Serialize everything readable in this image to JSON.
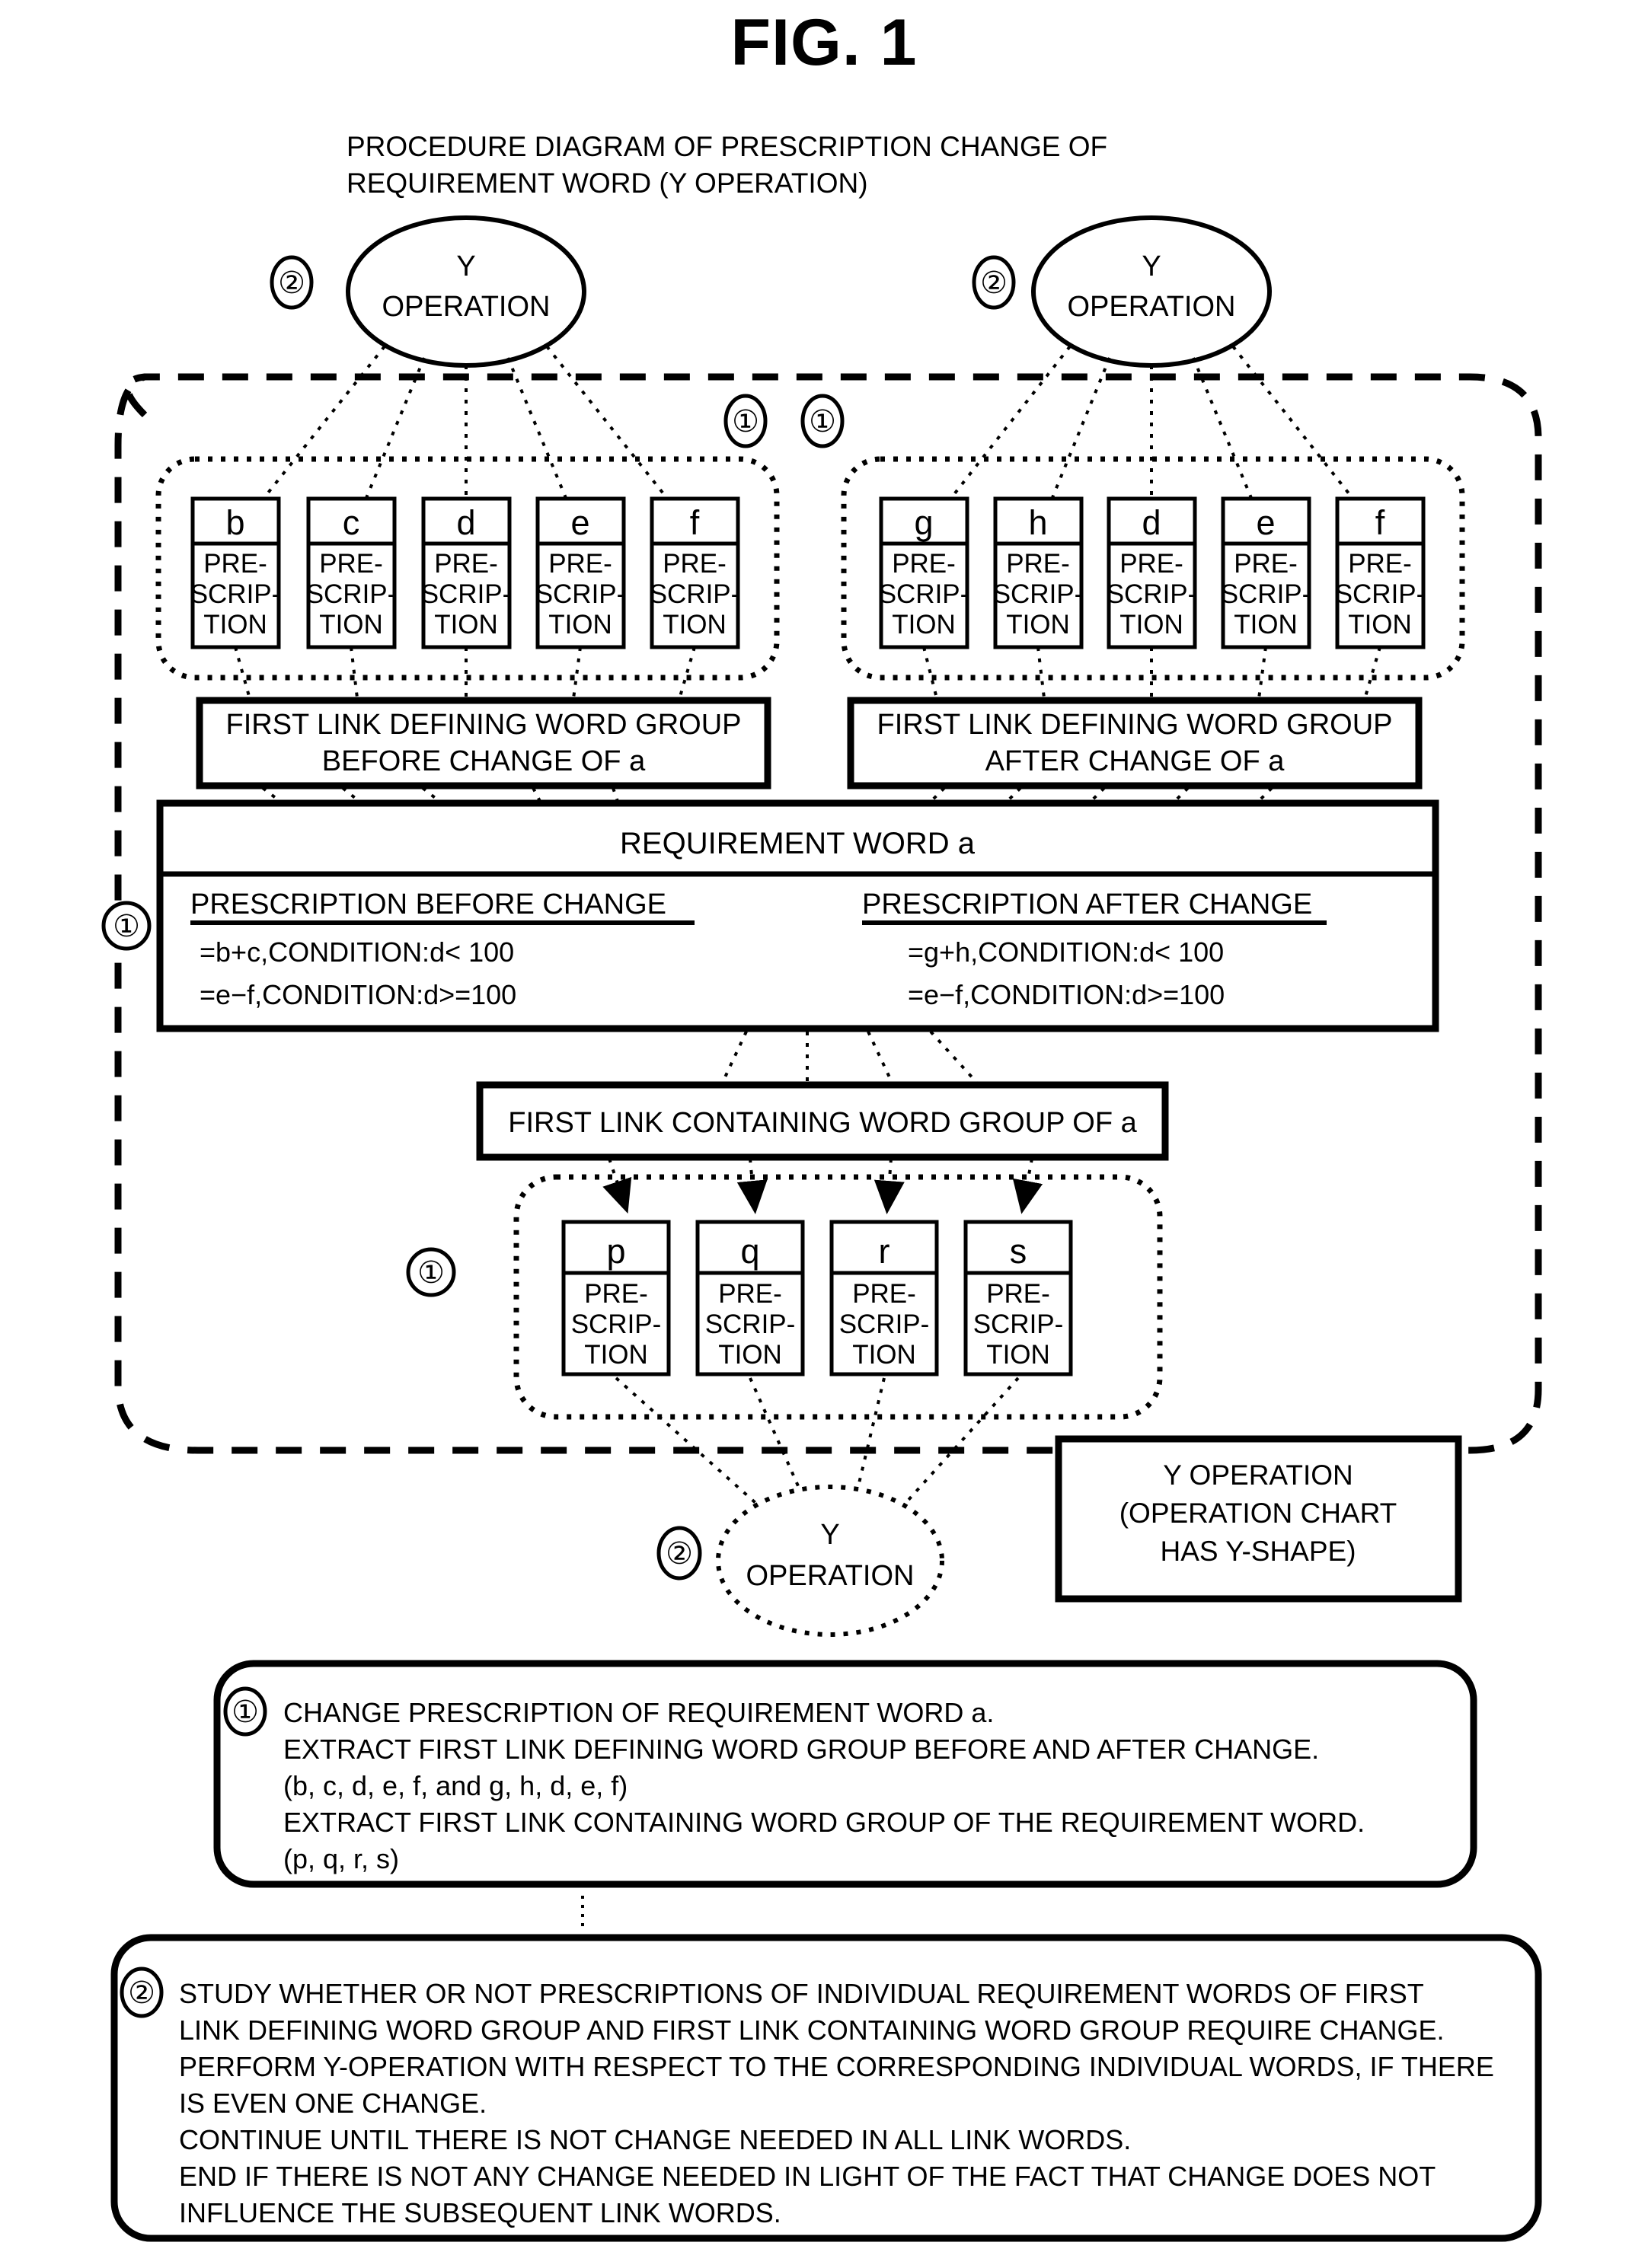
{
  "figure": {
    "title": "FIG. 1",
    "subtitle_line1": "PROCEDURE DIAGRAM OF PRESCRIPTION CHANGE OF",
    "subtitle_line2": "REQUIREMENT WORD (Y OPERATION)"
  },
  "markers": {
    "one": "①",
    "two": "②"
  },
  "operations": {
    "top_left": {
      "line1": "Y",
      "line2": "OPERATION",
      "marker": "②"
    },
    "top_right": {
      "line1": "Y",
      "line2": "OPERATION",
      "marker": "②"
    },
    "bottom": {
      "line1": "Y",
      "line2": "OPERATION",
      "marker": "②"
    }
  },
  "prescription_word": "PRE-\nSCRIP-\nTION",
  "prescription_lines": [
    "PRE-",
    "SCRIP-",
    "TION"
  ],
  "groups": {
    "before_change": {
      "label_line1": "FIRST LINK DEFINING WORD GROUP",
      "label_line2": "BEFORE CHANGE OF a",
      "words": [
        "b",
        "c",
        "d",
        "e",
        "f"
      ],
      "marker": "①"
    },
    "after_change": {
      "label_line1": "FIRST LINK DEFINING WORD GROUP",
      "label_line2": "AFTER CHANGE OF a",
      "words": [
        "g",
        "h",
        "d",
        "e",
        "f"
      ],
      "marker": "①"
    },
    "containing": {
      "label": "FIRST LINK CONTAINING WORD GROUP OF a",
      "words": [
        "p",
        "q",
        "r",
        "s"
      ],
      "marker": "①"
    }
  },
  "requirement_word_box": {
    "title": "REQUIREMENT WORD a",
    "marker": "①",
    "before": {
      "heading": "PRESCRIPTION BEFORE CHANGE",
      "lines": [
        "=b+c,CONDITION:d< 100",
        "=e−f,CONDITION:d>=100"
      ]
    },
    "after": {
      "heading": "PRESCRIPTION AFTER CHANGE",
      "lines": [
        "=g+h,CONDITION:d< 100",
        "=e−f,CONDITION:d>=100"
      ]
    }
  },
  "y_shape_note": {
    "line1": "Y OPERATION",
    "line2": "(OPERATION CHART",
    "line3": "HAS Y-SHAPE)"
  },
  "note_one": {
    "marker": "①",
    "lines": [
      "CHANGE PRESCRIPTION OF REQUIREMENT WORD a.",
      "EXTRACT  FIRST LINK DEFINING WORD GROUP BEFORE AND AFTER CHANGE.",
      "(b, c, d, e, f, and g, h, d, e, f)",
      "EXTRACT  FIRST LINK CONTAINING WORD GROUP OF THE REQUIREMENT WORD.",
      "(p, q, r, s)"
    ]
  },
  "note_two": {
    "marker": "②",
    "lines": [
      "STUDY WHETHER OR NOT PRESCRIPTIONS OF INDIVIDUAL REQUIREMENT WORDS OF  FIRST",
      "LINK DEFINING WORD GROUP AND  FIRST LINK CONTAINING WORD GROUP REQUIRE CHANGE.",
      "PERFORM Y-OPERATION WITH RESPECT TO THE CORRESPONDING INDIVIDUAL WORDS, IF THERE",
      "IS EVEN ONE CHANGE.",
      "CONTINUE UNTIL THERE IS NOT CHANGE NEEDED IN ALL LINK WORDS.",
      "END IF THERE IS NOT ANY CHANGE NEEDED IN LIGHT OF THE FACT THAT CHANGE DOES NOT",
      "INFLUENCE THE SUBSEQUENT LINK WORDS."
    ]
  },
  "colors": {
    "ink": "#000000",
    "paper": "#ffffff"
  }
}
